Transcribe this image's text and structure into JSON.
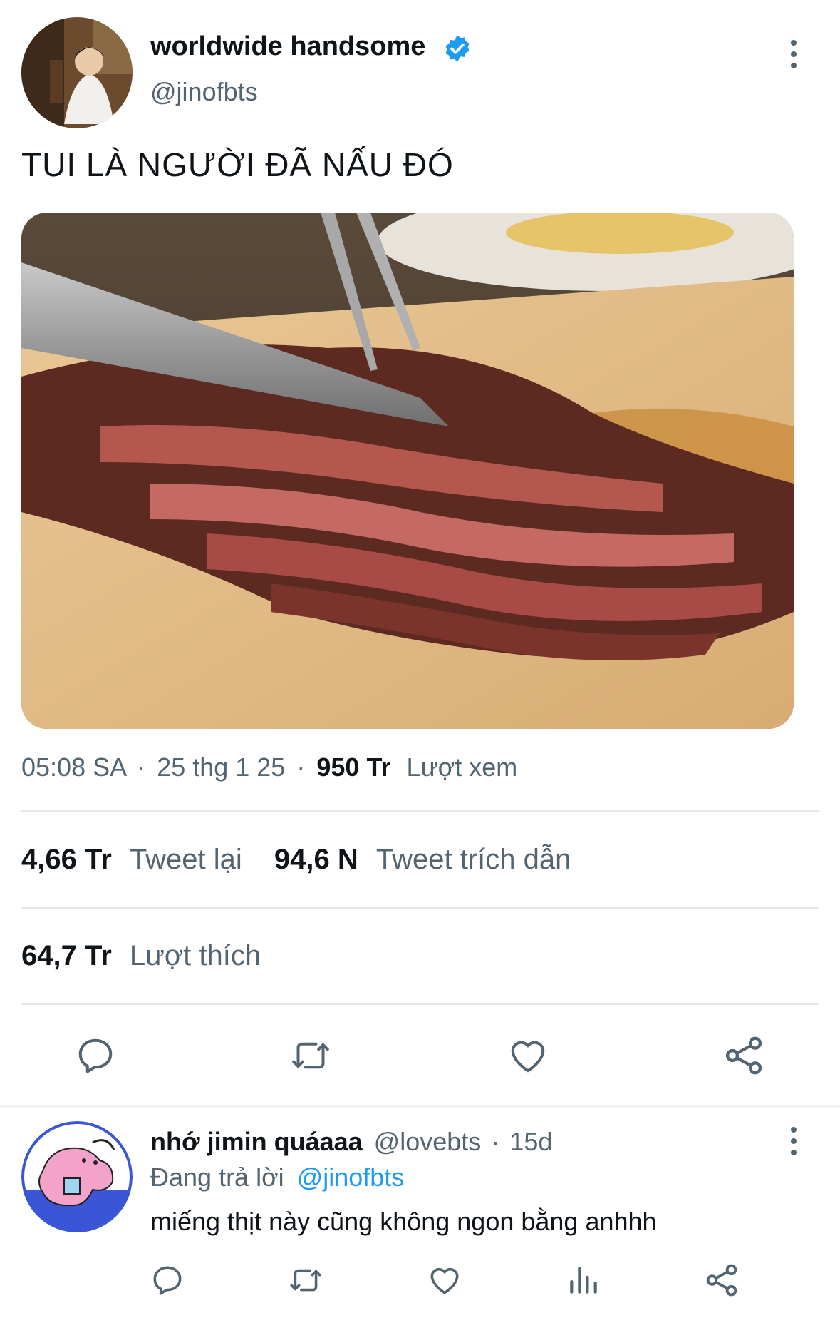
{
  "tweet": {
    "display_name": "worldwide handsome",
    "handle": "@jinofbts",
    "text": "TUI LÀ NGƯỜI ĐÃ NẤU ĐÓ",
    "time": "05:08 SA",
    "sep": "·",
    "date": "25 thg 1 25",
    "views_count": "950 Tr",
    "views_label": "Lượt xem",
    "retweets_count": "4,66 Tr",
    "retweets_label": "Tweet lại",
    "quotes_count": "94,6 N",
    "quotes_label": "Tweet trích dẫn",
    "likes_count": "64,7 Tr",
    "likes_label": "Lượt thích"
  },
  "reply": {
    "display_name": "nhớ jimin quáaaa",
    "handle": "@lovebts",
    "sep": "·",
    "age": "15d",
    "replying_label": "Đang trả lời",
    "replying_to": "@jinofbts",
    "text": "miếng thịt này cũng không ngon bằng anhhh"
  },
  "colors": {
    "accent": "#1d9bf0",
    "secondary_text": "#536471",
    "divider": "#e6e9ec"
  },
  "icons": [
    "verified-badge-icon",
    "more-vertical-icon",
    "reply-icon",
    "retweet-icon",
    "like-icon",
    "share-icon",
    "analytics-icon"
  ]
}
